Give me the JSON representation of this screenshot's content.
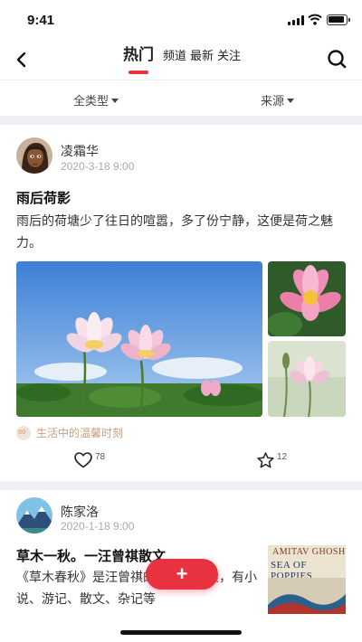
{
  "status_bar": {
    "time": "9:41"
  },
  "header": {
    "tabs": [
      {
        "label": "热门",
        "active": true
      },
      {
        "label": "频道"
      },
      {
        "label": "最新"
      },
      {
        "label": "关注"
      }
    ]
  },
  "filters": {
    "type_label": "全类型",
    "source_label": "来源"
  },
  "posts": [
    {
      "author": "凌霜华",
      "date": "2020-3-18   9:00",
      "title": "雨后荷影",
      "body": "雨后的荷塘少了往日的喧嚣，多了份宁静，这便是荷之魅力。",
      "tag": "生活中的温馨时刻",
      "likes": "78",
      "favorites": "12"
    },
    {
      "author": "陈家洛",
      "date": "2020-1-18   9:00",
      "title": "草木一秋。一汪曾祺散文",
      "body": "《草木春秋》是汪曾祺的一部作品集，有小说、游记、散文、杂记等",
      "book_author": "AMITAV GHOSH",
      "book_title": "SEA OF POPPIES"
    }
  ],
  "fab": {
    "label": "+"
  },
  "colors": {
    "accent": "#e8323f",
    "tag": "#c9a082",
    "divider": "#eef0f3"
  }
}
